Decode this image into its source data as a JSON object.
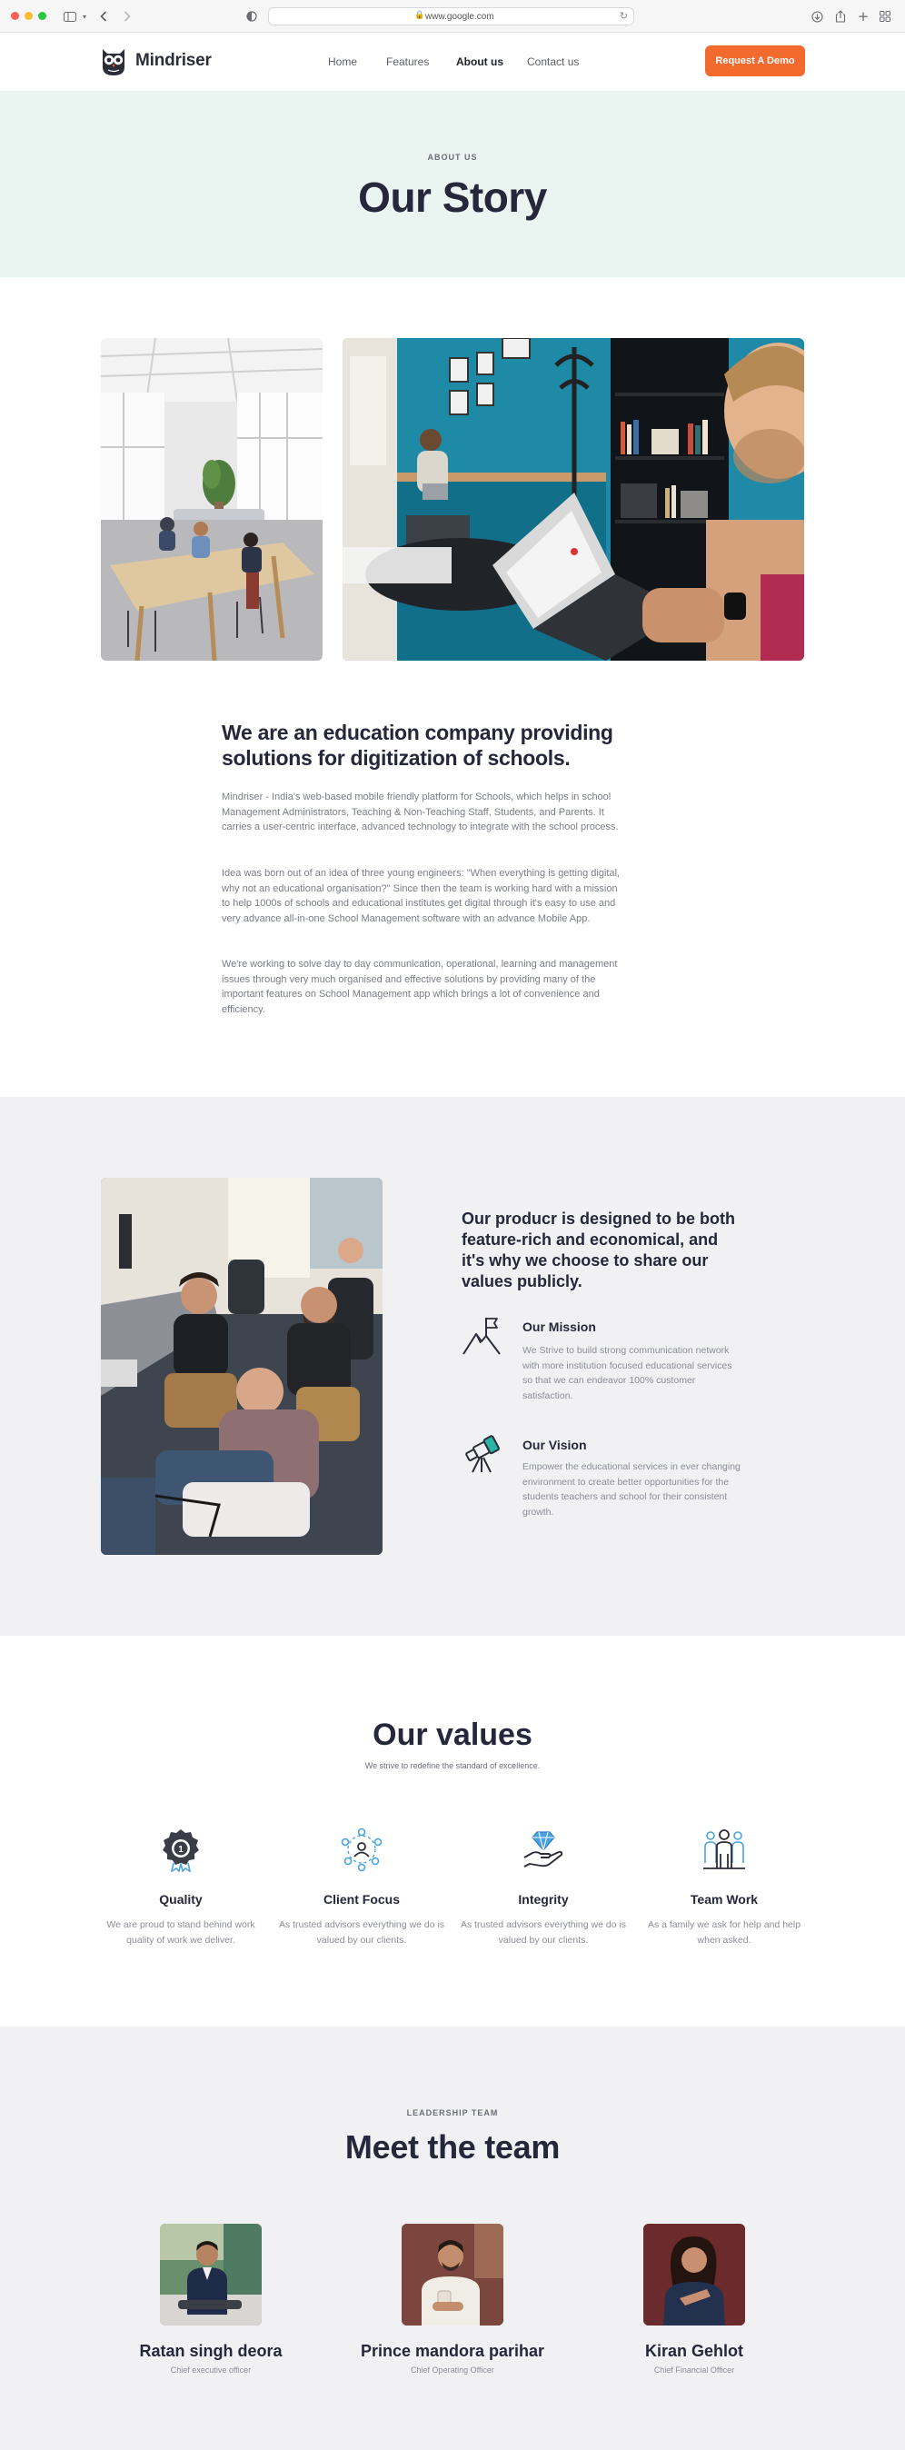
{
  "browser": {
    "url": "www.google.com"
  },
  "nav": {
    "brand": "Mindriser",
    "links": [
      "Home",
      "Features",
      "About us",
      "Contact us"
    ],
    "active_link": "About us",
    "cta": "Request A Demo"
  },
  "hero": {
    "eyebrow": "ABOUT US",
    "title": "Our Story"
  },
  "intro": {
    "title": "We are an education company providing solutions for digitization of schools.",
    "paragraphs": [
      "Mindriser - India's web-based mobile friendly platform for Schools, which helps in school Management Administrators, Teaching & Non-Teaching Staff, Students, and Parents. It carries a user-centric interface, advanced technology to integrate with the school process.",
      "Idea was born out of an idea of three young engineers: \"When everything is getting digital, why not an educational organisation?\" Since then the team is working hard with a mission to help 1000s of schools and educational institutes get digital through it's easy to use and very advance all-in-one School Management software with an advance Mobile App.",
      "We're working to solve day to day communication, operational, learning and management issues through very much organised and effective solutions by providing many of the important features on School Management app which brings a lot of convenience and efficiency."
    ]
  },
  "mission": {
    "title": "Our producr is designed to be both feature-rich and economical, and it's why we choose to share our values publicly.",
    "features": [
      {
        "icon": "mountain-flag-icon",
        "title": "Our Mission",
        "text": "We Strive to build strong communication network with more institution focused educational services so that we can endeavor 100% customer satisfaction."
      },
      {
        "icon": "telescope-icon",
        "title": "Our Vision",
        "text": "Empower the educational services in ever changing environment to create better opportunities for the students teachers and school for their consistent growth."
      }
    ]
  },
  "values": {
    "title": "Our values",
    "subtitle": "We strive to redefine the standard of excellence.",
    "items": [
      {
        "icon": "award-badge-icon",
        "title": "Quality",
        "text": "We are proud to stand behind work quality of work we deliver."
      },
      {
        "icon": "network-people-icon",
        "title": "Client Focus",
        "text": "As trusted advisors everything we do is valued by our clients."
      },
      {
        "icon": "hand-diamond-icon",
        "title": "Integrity",
        "text": "As trusted advisors everything we do is valued by our clients."
      },
      {
        "icon": "team-group-icon",
        "title": "Team Work",
        "text": "As a family we ask for help and help when asked."
      }
    ]
  },
  "team": {
    "eyebrow": "LEADERSHIP TEAM",
    "title": "Meet the team",
    "members": [
      {
        "name": "Ratan singh deora",
        "role": "Chief executive officer"
      },
      {
        "name": "Prince mandora parihar",
        "role": "Chief Operating Officer"
      },
      {
        "name": "Kiran Gehlot",
        "role": "Chief Financial Officer"
      }
    ]
  },
  "colors": {
    "accent": "#f26a2e",
    "hero_bg": "#eaf4f0",
    "section_bg": "#f1f1f4",
    "heading": "#25273a",
    "icon_blue": "#4aa3df",
    "icon_teal": "#2bb3a3"
  }
}
